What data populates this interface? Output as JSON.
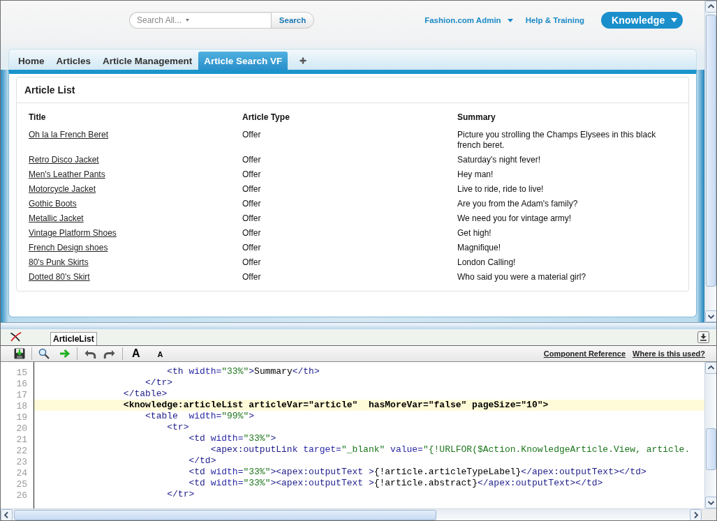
{
  "header": {
    "search": {
      "placeholder": "Search All...",
      "button": "Search"
    },
    "user_menu": "Fashion.com Admin",
    "help_link": "Help & Training",
    "app_menu": "Knowledge"
  },
  "tabs": [
    {
      "label": "Home",
      "selected": false
    },
    {
      "label": "Articles",
      "selected": false
    },
    {
      "label": "Article Management",
      "selected": false
    },
    {
      "label": "Article Search VF",
      "selected": true
    }
  ],
  "article_list": {
    "title": "Article List",
    "columns": [
      "Title",
      "Article Type",
      "Summary"
    ],
    "rows": [
      {
        "title": "Oh la la French Beret",
        "article_type": "Offer",
        "summary": "Picture you strolling the Champs Elysees in this black french beret."
      },
      {
        "title": "Retro Disco Jacket",
        "article_type": "Offer",
        "summary": "Saturday's night fever!"
      },
      {
        "title": "Men's Leather Pants",
        "article_type": "Offer",
        "summary": "Hey man!"
      },
      {
        "title": "Motorcycle Jacket",
        "article_type": "Offer",
        "summary": "Live to ride, ride to live!"
      },
      {
        "title": "Gothic Boots",
        "article_type": "Offer",
        "summary": "Are you from the Adam's family?"
      },
      {
        "title": "Metallic Jacket",
        "article_type": "Offer",
        "summary": "We need you for vintage army!"
      },
      {
        "title": "Vintage Platform Shoes",
        "article_type": "Offer",
        "summary": "Get high!"
      },
      {
        "title": "French Design shoes",
        "article_type": "Offer",
        "summary": "Magnifique!"
      },
      {
        "title": "80's Punk Skirts",
        "article_type": "Offer",
        "summary": "London Calling!"
      },
      {
        "title": "Dotted 80's Skirt",
        "article_type": "Offer",
        "summary": "Who said you were a material girl?"
      }
    ]
  },
  "developer_footer": {
    "tabs": [
      {
        "label": "ArticleList",
        "selected": true
      }
    ],
    "font_buttons": [
      "A",
      "A"
    ],
    "links": [
      "Component Reference",
      "Where is this used?"
    ],
    "editor": {
      "lines": [
        {
          "number": "15",
          "current": false,
          "parts": [
            {
              "kind": "tag",
              "text": "                        <th"
            },
            {
              "kind": "attr",
              "text": " width="
            },
            {
              "kind": "value",
              "text": "\"33%\""
            },
            {
              "kind": "tag",
              "text": ">"
            },
            {
              "kind": "text",
              "text": "Summary"
            },
            {
              "kind": "tag",
              "text": "</th>"
            }
          ]
        },
        {
          "number": "16",
          "current": false,
          "parts": [
            {
              "kind": "tag",
              "text": "                    </tr>"
            }
          ]
        },
        {
          "number": "17",
          "current": false,
          "parts": [
            {
              "kind": "tag",
              "text": "                </table>"
            }
          ]
        },
        {
          "number": "18",
          "current": true,
          "parts": [
            {
              "kind": "text",
              "text": "                <knowledge:articleList articleVar=\"article\"  hasMoreVar=\"false\" pageSize=\"10\">"
            }
          ]
        },
        {
          "number": "19",
          "current": false,
          "parts": [
            {
              "kind": "tag",
              "text": "                    <table"
            },
            {
              "kind": "attr",
              "text": "  width="
            },
            {
              "kind": "value",
              "text": "\"99%\""
            },
            {
              "kind": "tag",
              "text": ">"
            }
          ]
        },
        {
          "number": "20",
          "current": false,
          "parts": [
            {
              "kind": "tag",
              "text": "                        <tr>"
            }
          ]
        },
        {
          "number": "21",
          "current": false,
          "parts": [
            {
              "kind": "tag",
              "text": "                            <td"
            },
            {
              "kind": "attr",
              "text": " width="
            },
            {
              "kind": "value",
              "text": "\"33%\""
            },
            {
              "kind": "tag",
              "text": ">"
            }
          ]
        },
        {
          "number": "22",
          "current": false,
          "parts": [
            {
              "kind": "tag",
              "text": "                                <apex:outputLink"
            },
            {
              "kind": "attr",
              "text": " target="
            },
            {
              "kind": "value",
              "text": "\"_blank\""
            },
            {
              "kind": "attr",
              "text": " value="
            },
            {
              "kind": "value",
              "text": "\"{!URLFOR($Action.KnowledgeArticle.View, article."
            }
          ]
        },
        {
          "number": "23",
          "current": false,
          "parts": [
            {
              "kind": "tag",
              "text": "                            </td>"
            }
          ]
        },
        {
          "number": "24",
          "current": false,
          "parts": [
            {
              "kind": "tag",
              "text": "                            <td"
            },
            {
              "kind": "attr",
              "text": " width="
            },
            {
              "kind": "value",
              "text": "\"33%\""
            },
            {
              "kind": "tag",
              "text": "><apex:outputText >"
            },
            {
              "kind": "text",
              "text": "{!article.articleTypeLabel}"
            },
            {
              "kind": "tag",
              "text": "</apex:outputText></td>"
            }
          ]
        },
        {
          "number": "25",
          "current": false,
          "parts": [
            {
              "kind": "tag",
              "text": "                            <td"
            },
            {
              "kind": "attr",
              "text": " width="
            },
            {
              "kind": "value",
              "text": "\"33%\""
            },
            {
              "kind": "tag",
              "text": "><apex:outputText >"
            },
            {
              "kind": "text",
              "text": "{!article.abstract}"
            },
            {
              "kind": "tag",
              "text": "</apex:outputText></td>"
            }
          ]
        },
        {
          "number": "26",
          "current": false,
          "parts": [
            {
              "kind": "tag",
              "text": "                        </tr>"
            }
          ]
        }
      ]
    }
  }
}
